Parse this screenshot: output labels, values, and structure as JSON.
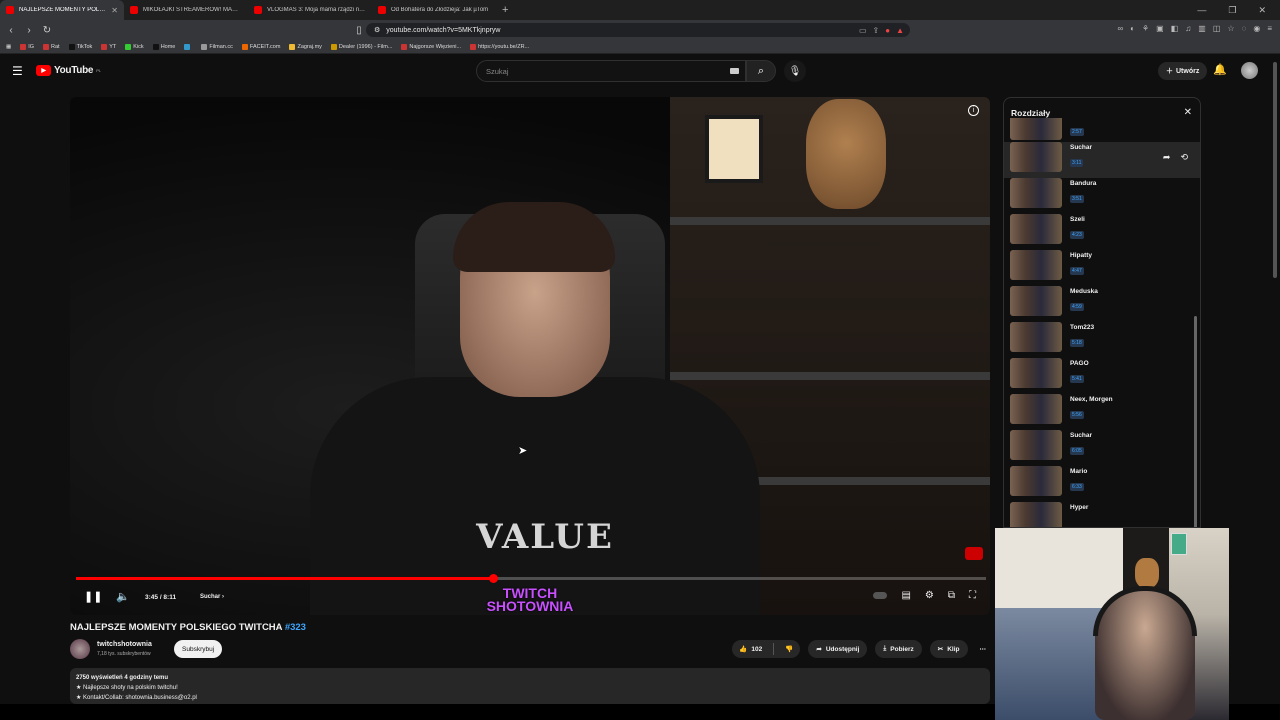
{
  "tabs": [
    {
      "label": "NAJLEPSZE MOMENTY POLSK",
      "active": true
    },
    {
      "label": "MIKOŁAJKI STREAMERÓW! MAMMO",
      "active": false
    },
    {
      "label": "VLOGMAS 3: Moja mama rządzi na k",
      "active": false
    },
    {
      "label": "Od Bohatera do Złodzieja: Jak µTom",
      "active": false
    }
  ],
  "address": {
    "url": "youtube.com/watch?v=5MKTkjnpryw"
  },
  "bookmarks": [
    "IG",
    "Rat",
    "TikTok",
    "YT",
    "Kick",
    "Home",
    "",
    "Filman.cc",
    "FACEIT.com",
    "Zagraj.my",
    "Dealer (1996) - Film...",
    "Najgorsze Więzieni...",
    "https://youtu.be/ZR..."
  ],
  "yt": {
    "logo_text": "YouTube",
    "logo_region": "PL",
    "search_placeholder": "Szukaj",
    "create_label": "Utwórz"
  },
  "player": {
    "time": "3:45 / 8:11",
    "chapter": "Suchar",
    "progress_fraction": 0.458,
    "hoodie_text": "VALUE",
    "watermark_line1": "TWITCH",
    "watermark_line2": "SHOTOWNIA"
  },
  "video": {
    "title": "NAJLEPSZE MOMENTY POLSKIEGO TWITCHA",
    "title_tag": "#323",
    "channel": "twitchshotownia",
    "subscribers": "7,18 tys. subskrybentów",
    "subscribe_label": "Subskrybuj",
    "likes": "102",
    "share_label": "Udostępnij",
    "download_label": "Pobierz",
    "clip_label": "Klip",
    "views_meta": "2750 wyświetleń  4 godziny temu",
    "desc_line1": "★ Najlepsze shoty na polskim twitchu!",
    "desc_line2": "★ Kontakt/Collab: shotownia.business@o2.pl"
  },
  "chapters_panel": {
    "heading": "Rozdziały",
    "items": [
      {
        "title": "",
        "time": "2:57"
      },
      {
        "title": "Suchar",
        "time": "3:11",
        "current": true
      },
      {
        "title": "Bandura",
        "time": "3:51"
      },
      {
        "title": "Szeli",
        "time": "4:23"
      },
      {
        "title": "Hipatty",
        "time": "4:47"
      },
      {
        "title": "Meduska",
        "time": "4:59"
      },
      {
        "title": "Tom223",
        "time": "5:18"
      },
      {
        "title": "PAGO",
        "time": "5:41"
      },
      {
        "title": "Neex, Morgen",
        "time": "5:56"
      },
      {
        "title": "Suchar",
        "time": "6:05"
      },
      {
        "title": "Mario",
        "time": "6:33"
      },
      {
        "title": "Hyper",
        "time": ""
      }
    ]
  },
  "colors": {
    "accent_red": "#ff0000",
    "link_blue": "#3ea6ff",
    "bg": "#0f0f0f"
  }
}
